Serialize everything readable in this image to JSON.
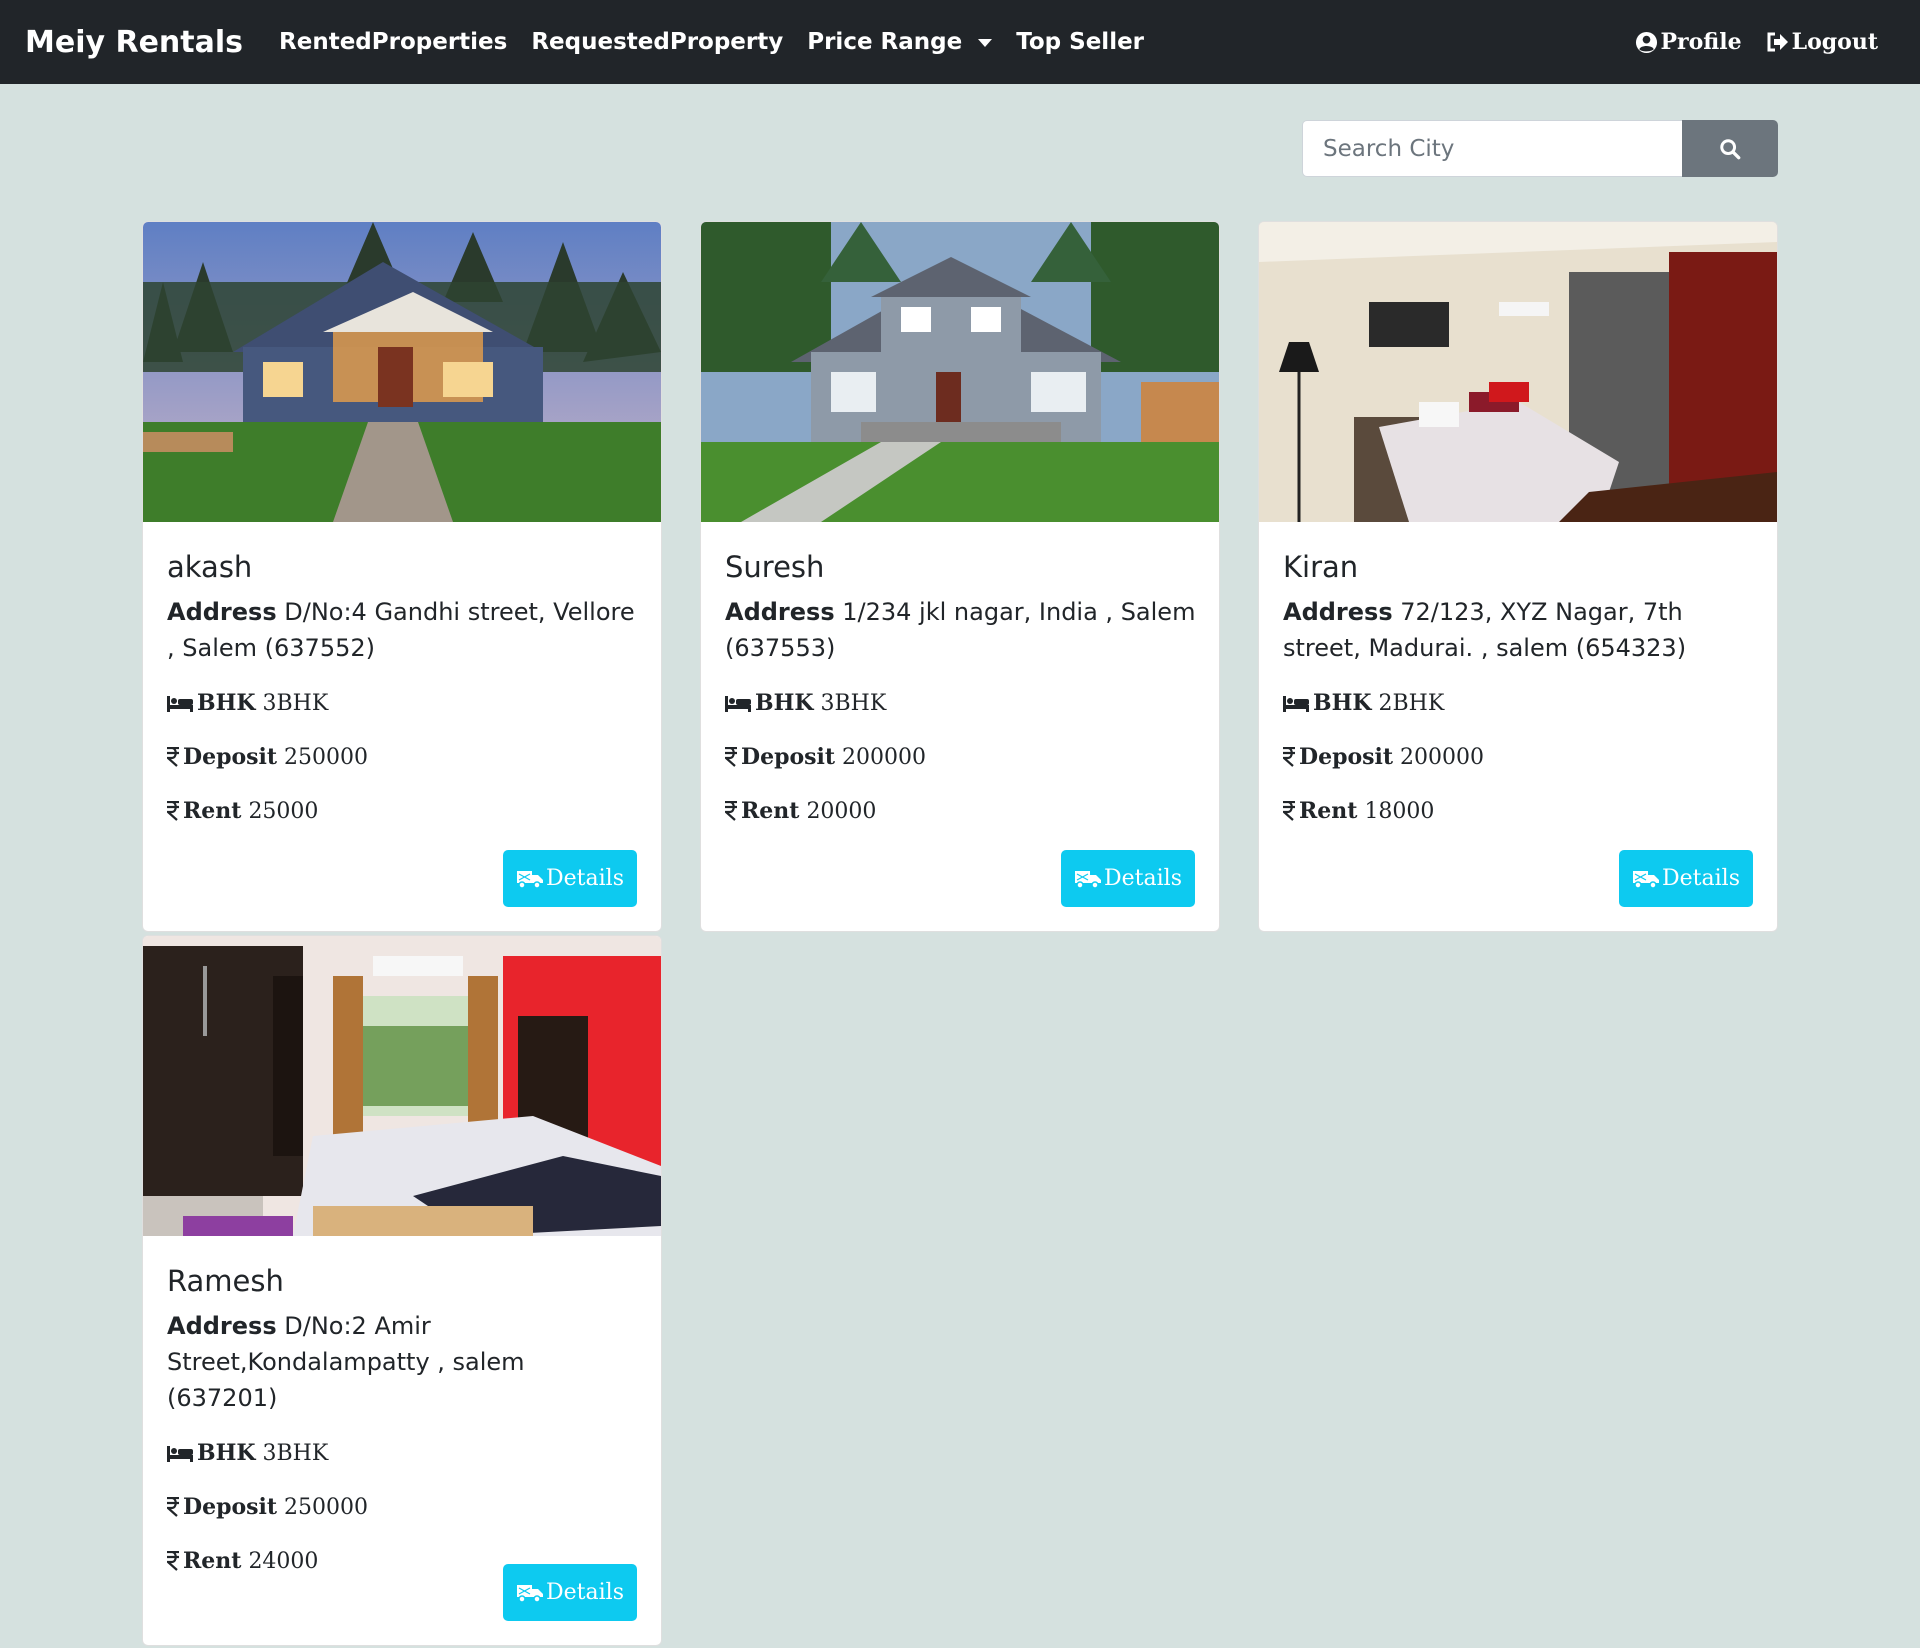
{
  "navbar": {
    "brand": "Meiy Rentals",
    "links": [
      "RentedProperties",
      "RequestedProperty",
      "Price Range",
      "Top Seller"
    ],
    "profile": "Profile",
    "logout": "Logout"
  },
  "search": {
    "placeholder": "Search City"
  },
  "labels": {
    "address": "Address",
    "bhk": "BHK",
    "deposit": "Deposit",
    "rent": "Rent",
    "details": "Details"
  },
  "properties": [
    {
      "owner": "akash",
      "address": "D/No:4 Gandhi street, Vellore , Salem (637552)",
      "bhk": "3BHK",
      "deposit": "250000",
      "rent": "25000",
      "image": "house exterior with stone path at dusk"
    },
    {
      "owner": "Suresh",
      "address": "1/234 jkl nagar, India , Salem (637553)",
      "bhk": "3BHK",
      "deposit": "200000",
      "rent": "20000",
      "image": "two-story grey house with lawn"
    },
    {
      "owner": "Kiran",
      "address": "72/123, XYZ Nagar, 7th street, Madurai. , salem (654323)",
      "bhk": "2BHK",
      "deposit": "200000",
      "rent": "18000",
      "image": "bedroom with red wall panel"
    },
    {
      "owner": "Ramesh",
      "address": "D/No:2 Amir Street,Kondalampatty , salem (637201)",
      "bhk": "3BHK",
      "deposit": "250000",
      "rent": "24000",
      "image": "bedroom with red wall and wardrobe"
    }
  ]
}
